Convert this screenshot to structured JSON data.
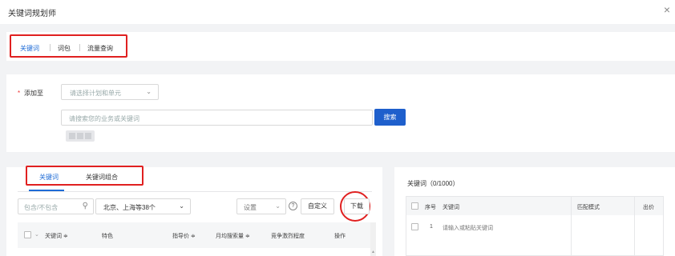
{
  "window": {
    "title": "关键词规划师",
    "close_symbol": "×"
  },
  "top_tabs": [
    {
      "label": "关键词",
      "active": true
    },
    {
      "label": "词包",
      "active": false
    },
    {
      "label": "流量查询",
      "active": false
    }
  ],
  "add_section": {
    "required_mark": "*",
    "label": "添加至",
    "plan_select_placeholder": "请选择计划和单元",
    "search_placeholder": "请搜索您的业务或关键词",
    "search_button": "搜索"
  },
  "left_panel": {
    "tabs": [
      {
        "label": "关键词",
        "active": true
      },
      {
        "label": "关键词组合",
        "active": false
      }
    ],
    "filter_placeholder": "包含/不包含",
    "region_value": "北京、上海等38个",
    "settings_value": "设置",
    "help_symbol": "?",
    "custom_button": "自定义",
    "download_button": "下载",
    "table_headers": [
      "关键词 ≑",
      "特色",
      "指导价 ≑",
      "月均搜索量 ≑",
      "竞争激烈程度",
      "操作"
    ]
  },
  "right_panel": {
    "title": "关键词（0/1000）",
    "headers": [
      "序号",
      "关键词",
      "匹配模式",
      "出价"
    ],
    "rows": [
      {
        "index": "1",
        "placeholder": "请输入或粘贴关键词"
      }
    ]
  },
  "colors": {
    "accent": "#1e6bd6",
    "primary_button": "#1e5fcc",
    "highlight": "#e02020"
  }
}
